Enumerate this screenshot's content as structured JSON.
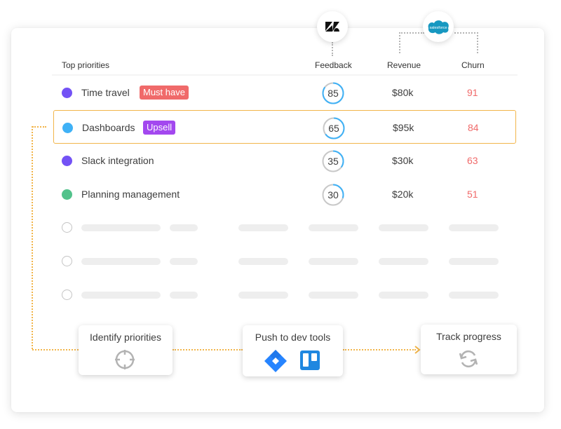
{
  "integrations": {
    "feedback_source": "zendesk-logo-icon",
    "revenue_churn_source": "salesforce-logo-icon",
    "salesforce_label": "salesforce"
  },
  "table": {
    "headers": {
      "priorities": "Top priorities",
      "feedback": "Feedback",
      "revenue": "Revenue",
      "churn": "Churn"
    },
    "rows": [
      {
        "name": "Time travel",
        "dot_color": "#7352f5",
        "tag": "Must have",
        "tag_color": "#f06a6a",
        "feedback": "85",
        "feedback_pct": 85,
        "revenue": "$80k",
        "churn": "91",
        "highlighted": false
      },
      {
        "name": "Dashboards",
        "dot_color": "#3fb1f6",
        "tag": "Upsell",
        "tag_color": "#a348ef",
        "feedback": "65",
        "feedback_pct": 65,
        "revenue": "$95k",
        "churn": "84",
        "highlighted": true
      },
      {
        "name": "Slack integration",
        "dot_color": "#7352f5",
        "tag": null,
        "tag_color": null,
        "feedback": "35",
        "feedback_pct": 35,
        "revenue": "$30k",
        "churn": "63",
        "highlighted": false
      },
      {
        "name": "Planning management",
        "dot_color": "#52c28b",
        "tag": null,
        "tag_color": null,
        "feedback": "30",
        "feedback_pct": 30,
        "revenue": "$20k",
        "churn": "51",
        "highlighted": false
      }
    ],
    "placeholder_rows": 3
  },
  "workflow": {
    "steps": [
      {
        "title": "Identify priorities",
        "icon": "crosshair-icon"
      },
      {
        "title": "Push to dev tools",
        "icons": [
          "jira-logo-icon",
          "trello-logo-icon"
        ]
      },
      {
        "title": "Track progress",
        "icon": "sync-icon"
      }
    ]
  },
  "colors": {
    "accent_flow": "#f2b54a",
    "ring_fill": "#3fb1f6",
    "ring_track": "#c8c8c8",
    "churn_text": "#f06a6a",
    "jira": "#2684ff",
    "trello": "#0079bf",
    "salesforce": "#1798c1"
  }
}
